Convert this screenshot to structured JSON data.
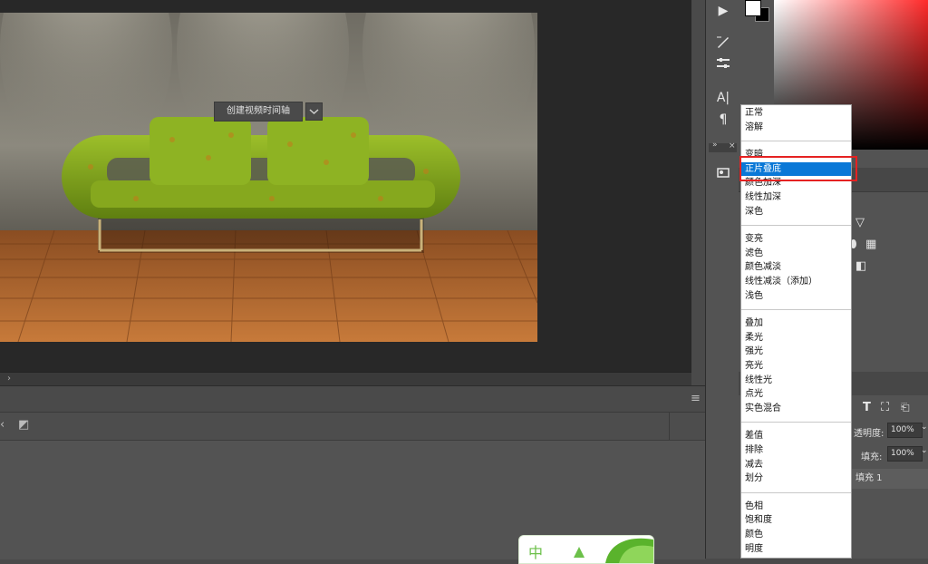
{
  "timeline": {
    "create_video_timeline_label": "创建视频时间轴"
  },
  "blend_modes": {
    "groups": [
      [
        "正常",
        "溶解"
      ],
      [
        "变暗",
        "正片叠底",
        "颜色加深",
        "线性加深",
        "深色"
      ],
      [
        "变亮",
        "滤色",
        "颜色减淡",
        "线性减淡（添加）",
        "浅色"
      ],
      [
        "叠加",
        "柔光",
        "强光",
        "亮光",
        "线性光",
        "点光",
        "实色混合"
      ],
      [
        "差值",
        "排除",
        "减去",
        "划分"
      ],
      [
        "色相",
        "饱和度",
        "颜色",
        "明度"
      ]
    ],
    "selected": "正片叠底"
  },
  "layers_panel": {
    "opacity_label": "透明度:",
    "opacity_value": "100%",
    "fill_label": "填充:",
    "fill_value": "100%",
    "layer_name": "填充 1"
  },
  "logo_text": "中",
  "colors": {
    "foreground": "#ffffff",
    "background": "#000000",
    "selection": "#0a78d7",
    "highlight_box": "#e52222"
  }
}
